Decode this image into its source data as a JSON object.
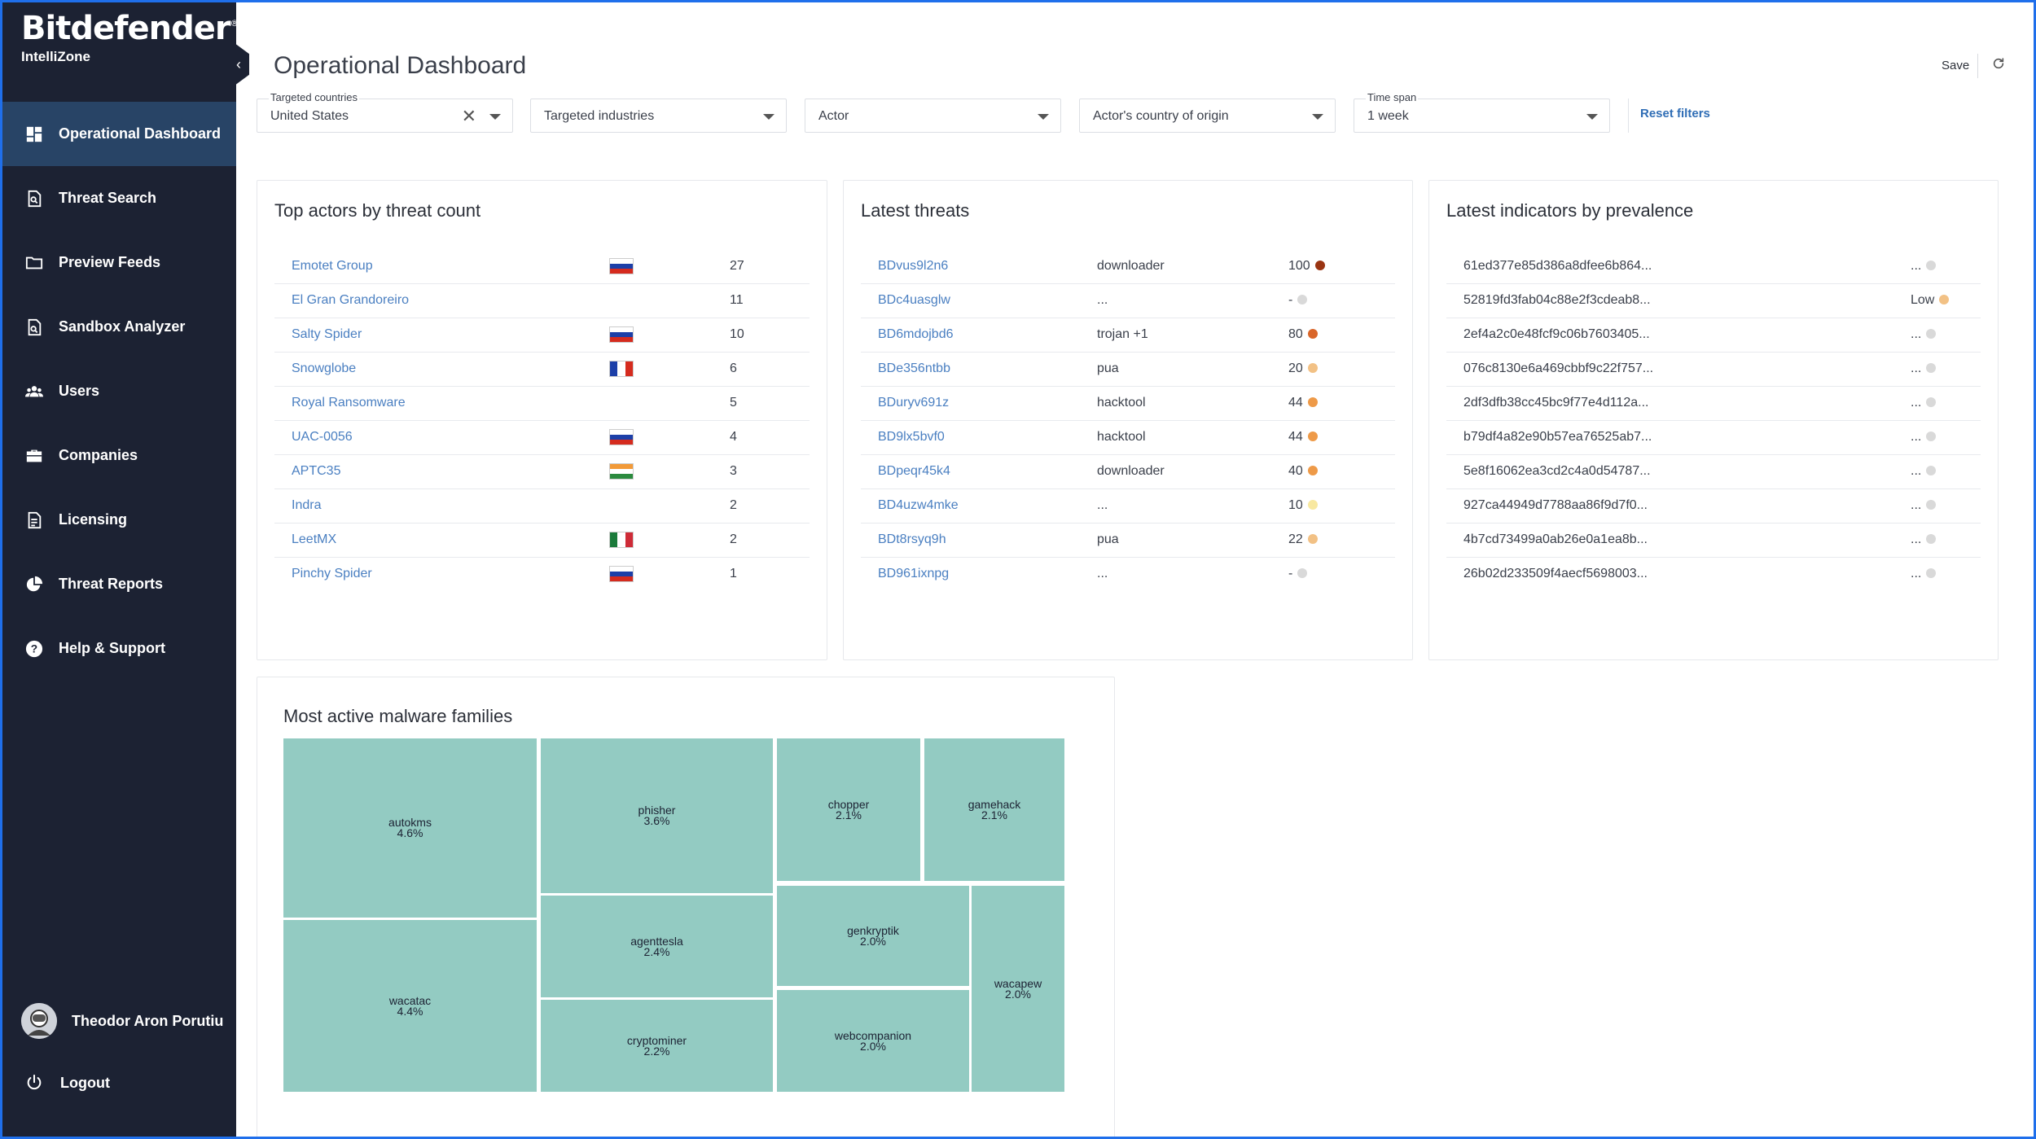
{
  "brand": {
    "name": "Bitdefender",
    "reg": "®",
    "product": "IntelliZone"
  },
  "sidebar": {
    "items": [
      {
        "label": "Operational Dashboard",
        "icon": "dashboard-icon",
        "active": true
      },
      {
        "label": "Threat Search",
        "icon": "threat-search-icon"
      },
      {
        "label": "Preview Feeds",
        "icon": "folder-icon"
      },
      {
        "label": "Sandbox Analyzer",
        "icon": "sandbox-icon"
      },
      {
        "label": "Users",
        "icon": "users-icon"
      },
      {
        "label": "Companies",
        "icon": "briefcase-icon"
      },
      {
        "label": "Licensing",
        "icon": "document-icon"
      },
      {
        "label": "Threat Reports",
        "icon": "pie-chart-icon"
      },
      {
        "label": "Help & Support",
        "icon": "help-icon"
      }
    ],
    "user": "Theodor Aron Porutiu",
    "logout": "Logout"
  },
  "header": {
    "title": "Operational Dashboard",
    "save": "Save"
  },
  "filters": {
    "countries": {
      "label": "Targeted countries",
      "value": "United States"
    },
    "industries": {
      "value": "Targeted industries"
    },
    "actor": {
      "value": "Actor"
    },
    "origin": {
      "value": "Actor's country of origin"
    },
    "timespan": {
      "label": "Time span",
      "value": "1 week"
    },
    "reset": "Reset filters"
  },
  "colors": {
    "sidebar": "#1c2233",
    "active": "#284466",
    "link": "#4a7fc1",
    "treemap": "#93cbc2"
  },
  "top_actors": {
    "title": "Top actors by threat count",
    "rows": [
      {
        "name": "Emotet Group",
        "flag": "ru",
        "count": "27"
      },
      {
        "name": "El Gran Grandoreiro",
        "flag": "",
        "count": "11"
      },
      {
        "name": "Salty Spider",
        "flag": "ru",
        "count": "10"
      },
      {
        "name": "Snowglobe",
        "flag": "fr",
        "count": "6"
      },
      {
        "name": "Royal Ransomware",
        "flag": "",
        "count": "5"
      },
      {
        "name": "UAC-0056",
        "flag": "ru",
        "count": "4"
      },
      {
        "name": "APTC35",
        "flag": "in",
        "count": "3"
      },
      {
        "name": "Indra",
        "flag": "",
        "count": "2"
      },
      {
        "name": "LeetMX",
        "flag": "mx",
        "count": "2"
      },
      {
        "name": "Pinchy Spider",
        "flag": "ru",
        "count": "1"
      }
    ]
  },
  "latest_threats": {
    "title": "Latest threats",
    "rows": [
      {
        "id": "BDvus9l2n6",
        "type": "downloader",
        "score": "100",
        "color": "#9a3412"
      },
      {
        "id": "BDc4uasglw",
        "type": "...",
        "score": "-",
        "color": "#d9d9d9"
      },
      {
        "id": "BD6mdojbd6",
        "type": "trojan +1",
        "score": "80",
        "color": "#d9662a"
      },
      {
        "id": "BDe356ntbb",
        "type": "pua",
        "score": "20",
        "color": "#f2c185"
      },
      {
        "id": "BDuryv691z",
        "type": "hacktool",
        "score": "44",
        "color": "#ee9a48"
      },
      {
        "id": "BD9lx5bvf0",
        "type": "hacktool",
        "score": "44",
        "color": "#ee9a48"
      },
      {
        "id": "BDpeqr45k4",
        "type": "downloader",
        "score": "40",
        "color": "#ee9a48"
      },
      {
        "id": "BD4uzw4mke",
        "type": "...",
        "score": "10",
        "color": "#f8e8a0"
      },
      {
        "id": "BDt8rsyq9h",
        "type": "pua",
        "score": "22",
        "color": "#f2c185"
      },
      {
        "id": "BD961ixnpg",
        "type": "...",
        "score": "-",
        "color": "#d9d9d9"
      }
    ]
  },
  "latest_indicators": {
    "title": "Latest indicators by prevalence",
    "rows": [
      {
        "hash": "61ed377e85d386a8dfee6b864...",
        "prev": "...",
        "color": "#d9d9d9"
      },
      {
        "hash": "52819fd3fab04c88e2f3cdeab8...",
        "prev": "Low",
        "color": "#f2c185"
      },
      {
        "hash": "2ef4a2c0e48fcf9c06b7603405...",
        "prev": "...",
        "color": "#d9d9d9"
      },
      {
        "hash": "076c8130e6a469cbbf9c22f757...",
        "prev": "...",
        "color": "#d9d9d9"
      },
      {
        "hash": "2df3dfb38cc45bc9f77e4d112a...",
        "prev": "...",
        "color": "#d9d9d9"
      },
      {
        "hash": "b79df4a82e90b57ea76525ab7...",
        "prev": "...",
        "color": "#d9d9d9"
      },
      {
        "hash": "5e8f16062ea3cd2c4a0d54787...",
        "prev": "...",
        "color": "#d9d9d9"
      },
      {
        "hash": "927ca44949d7788aa86f9d7f0...",
        "prev": "...",
        "color": "#d9d9d9"
      },
      {
        "hash": "4b7cd73499a0ab26e0a1ea8b...",
        "prev": "...",
        "color": "#d9d9d9"
      },
      {
        "hash": "26b02d233509f4aecf5698003...",
        "prev": "...",
        "color": "#d9d9d9"
      }
    ]
  },
  "malware": {
    "title": "Most active malware families",
    "cells": [
      {
        "name": "autokms",
        "pct": "4.6%"
      },
      {
        "name": "wacatac",
        "pct": "4.4%"
      },
      {
        "name": "phisher",
        "pct": "3.6%"
      },
      {
        "name": "agenttesla",
        "pct": "2.4%"
      },
      {
        "name": "cryptominer",
        "pct": "2.2%"
      },
      {
        "name": "chopper",
        "pct": "2.1%"
      },
      {
        "name": "gamehack",
        "pct": "2.1%"
      },
      {
        "name": "genkryptik",
        "pct": "2.0%"
      },
      {
        "name": "webcompanion",
        "pct": "2.0%"
      },
      {
        "name": "wacapew",
        "pct": "2.0%"
      }
    ]
  }
}
